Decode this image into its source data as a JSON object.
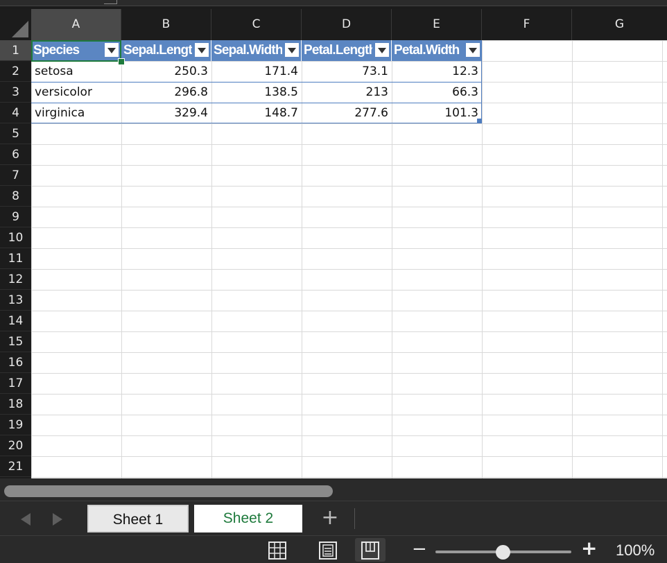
{
  "columns": [
    "A",
    "B",
    "C",
    "D",
    "E",
    "F",
    "G"
  ],
  "rows": [
    "1",
    "2",
    "3",
    "4",
    "5",
    "6",
    "7",
    "8",
    "9",
    "10",
    "11",
    "12",
    "13",
    "14",
    "15",
    "16",
    "17",
    "18",
    "19",
    "20",
    "21"
  ],
  "table": {
    "headers": [
      "Species",
      "Sepal.Length",
      "Sepal.Width",
      "Petal.Length",
      "Petal.Width"
    ],
    "data": [
      [
        "setosa",
        "250.3",
        "171.4",
        "73.1",
        "12.3"
      ],
      [
        "versicolor",
        "296.8",
        "138.5",
        "213",
        "66.3"
      ],
      [
        "virginica",
        "329.4",
        "148.7",
        "277.6",
        "101.3"
      ]
    ]
  },
  "sheets": [
    {
      "name": "Sheet 1",
      "active": false
    },
    {
      "name": "Sheet 2",
      "active": true
    }
  ],
  "add_sheet_label": "+",
  "zoom": {
    "minus": "−",
    "plus": "+",
    "level": "100%"
  },
  "colors": {
    "header_fill": "#5b86c2",
    "active_tab_text": "#1e7a3c",
    "selection": "#1e7a3c"
  }
}
